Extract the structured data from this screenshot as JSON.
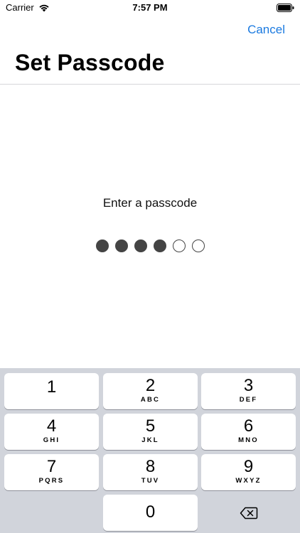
{
  "status_bar": {
    "carrier": "Carrier",
    "time": "7:57 PM"
  },
  "nav": {
    "cancel_label": "Cancel",
    "title": "Set Passcode"
  },
  "passcode": {
    "prompt": "Enter a passcode",
    "length": 6,
    "filled": 4
  },
  "keypad": {
    "keys": [
      {
        "digit": "1",
        "letters": ""
      },
      {
        "digit": "2",
        "letters": "ABC"
      },
      {
        "digit": "3",
        "letters": "DEF"
      },
      {
        "digit": "4",
        "letters": "GHI"
      },
      {
        "digit": "5",
        "letters": "JKL"
      },
      {
        "digit": "6",
        "letters": "MNO"
      },
      {
        "digit": "7",
        "letters": "PQRS"
      },
      {
        "digit": "8",
        "letters": "TUV"
      },
      {
        "digit": "9",
        "letters": "WXYZ"
      }
    ],
    "zero": "0"
  },
  "colors": {
    "accent": "#1b7ae0",
    "keyboard_bg": "#d1d4db",
    "dot": "#444444"
  }
}
